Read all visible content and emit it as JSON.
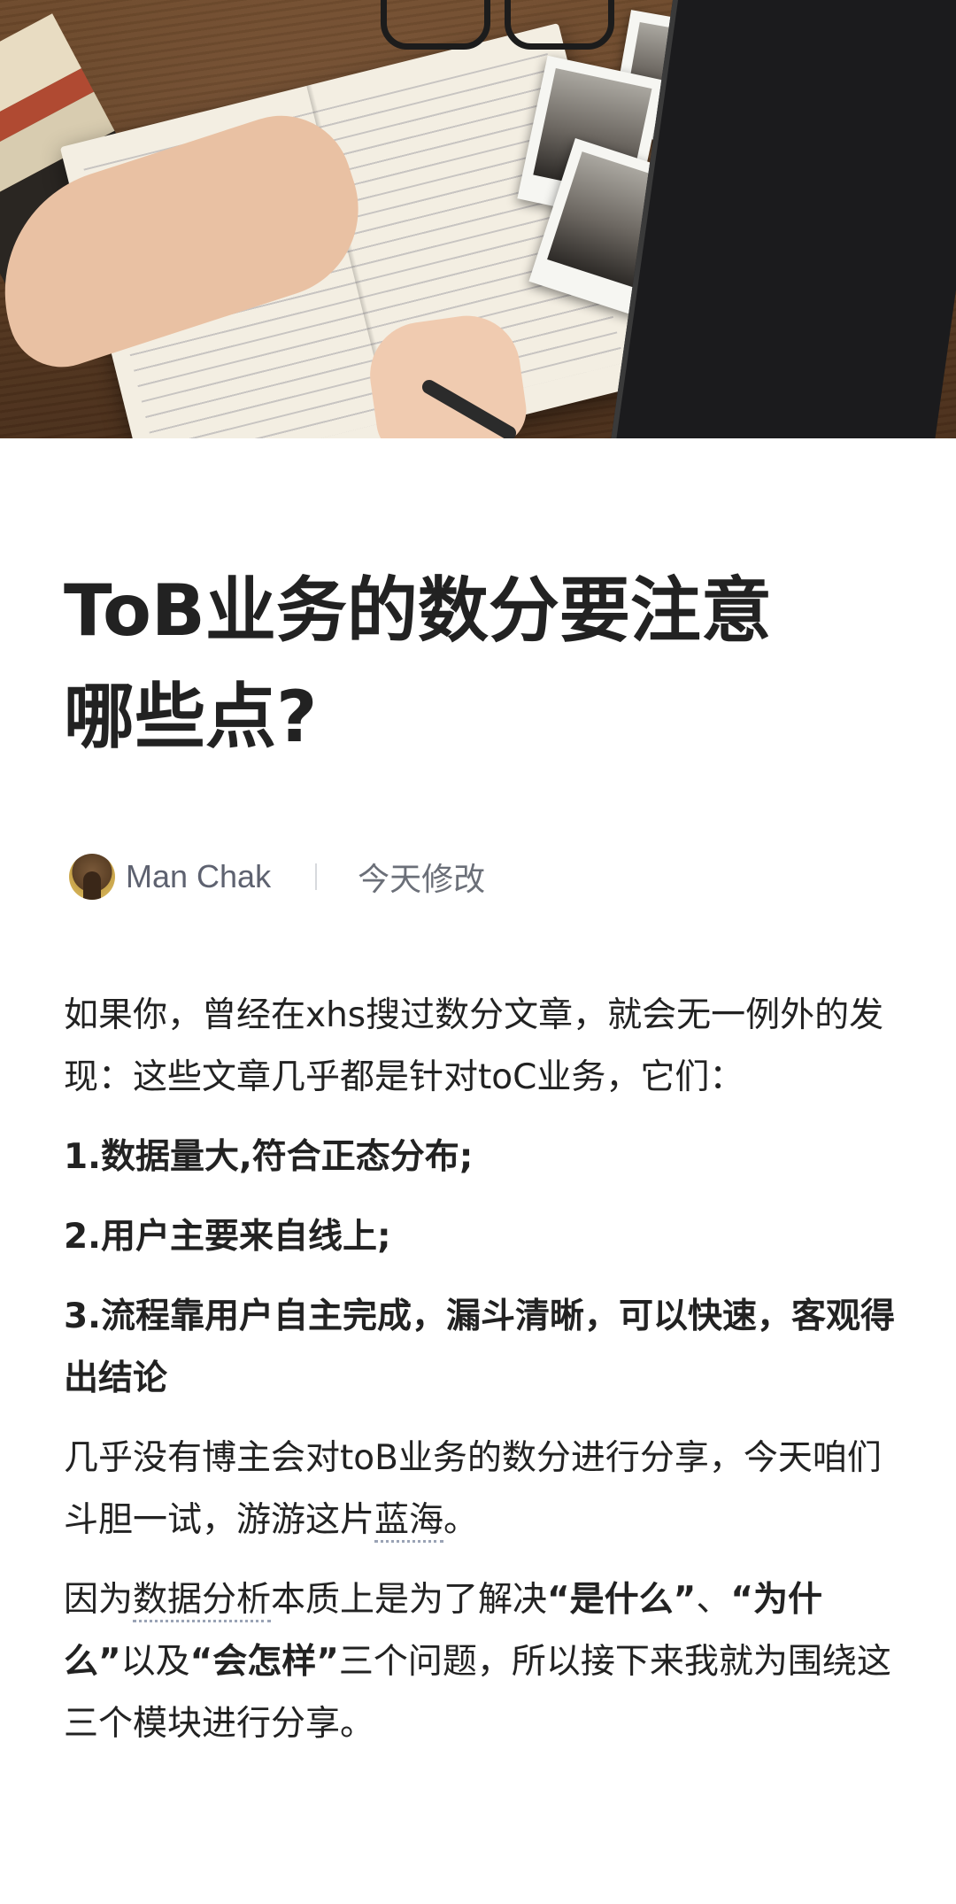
{
  "hero": {
    "icon": "desk-notebook-photo"
  },
  "article": {
    "title_line1": "ToB业务的数分要注意",
    "title_line2": "哪些点?",
    "author": "Man Chak",
    "date": "今天修改",
    "p1": "如果你，曾经在xhs搜过数分文章，就会无一例外的发现：这些文章几乎都是针对toC业务，它们：",
    "item1": "1.数据量大,符合正态分布;",
    "item2": "2.用户主要来自线上;",
    "item3": "3.流程靠用户自主完成，漏斗清晰，可以快速，客观得出结论",
    "p2_part1": "几乎没有博主会对toB业务的数分进行分享，今天咱们斗胆一试，游游这片",
    "p2_link": "蓝海",
    "p2_part2": "。",
    "p3_part1": "因为",
    "p3_link": "数据分析",
    "p3_part2": "本质上是为了解决",
    "p3_bold1": "“是什么”",
    "p3_part3": "、",
    "p3_bold2": "“为什么”",
    "p3_part4": "以及",
    "p3_bold3": "“会怎样”",
    "p3_part5": "三个问题，所以接下来我就为围绕这三个模块进行分享。"
  }
}
